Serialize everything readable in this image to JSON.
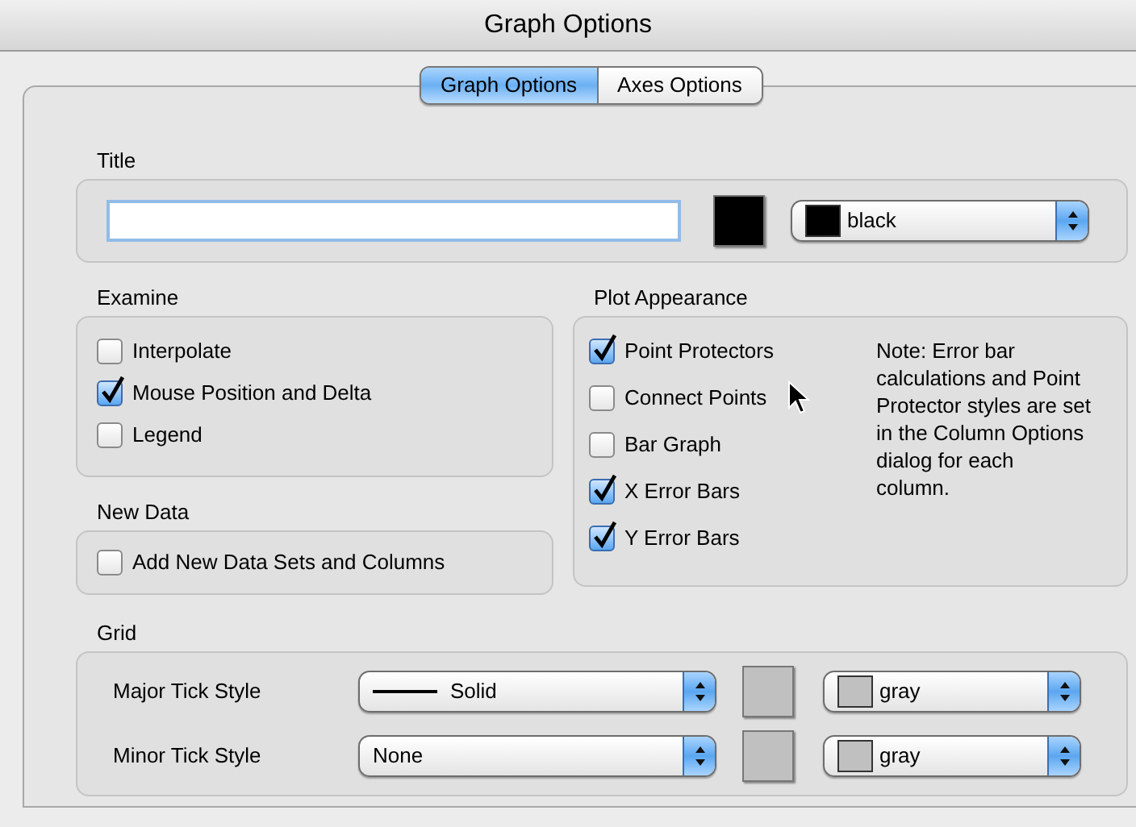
{
  "window": {
    "title": "Graph Options"
  },
  "tabs": [
    {
      "label": "Graph Options",
      "selected": true
    },
    {
      "label": "Axes Options",
      "selected": false
    }
  ],
  "title_section": {
    "label": "Title",
    "color_swatch": {
      "color": "#000000"
    },
    "color_select": {
      "label": "black",
      "color": "#000000"
    }
  },
  "examine": {
    "label": "Examine",
    "options": [
      {
        "label": "Interpolate",
        "checked": false
      },
      {
        "label": "Mouse Position and Delta",
        "checked": true
      },
      {
        "label": "Legend",
        "checked": false
      }
    ]
  },
  "new_data": {
    "label": "New Data",
    "options": [
      {
        "label": "Add New Data Sets and Columns",
        "checked": false
      }
    ]
  },
  "plot_appearance": {
    "label": "Plot Appearance",
    "options": [
      {
        "label": "Point Protectors",
        "checked": true
      },
      {
        "label": "Connect Points",
        "checked": false
      },
      {
        "label": "Bar Graph",
        "checked": false
      },
      {
        "label": "X Error Bars",
        "checked": true
      },
      {
        "label": "Y Error Bars",
        "checked": true
      }
    ],
    "note": "Note: Error bar calculations and Point Protector styles are set in the Column Options dialog for each column."
  },
  "grid": {
    "label": "Grid",
    "rows": [
      {
        "label": "Major Tick Style",
        "style": {
          "label": "Solid",
          "kind": "line"
        },
        "swatch": {
          "color": "#c0c0c0"
        },
        "color_select": {
          "label": "gray",
          "color": "#c0c0c0"
        }
      },
      {
        "label": "Minor Tick Style",
        "style": {
          "label": "None",
          "kind": "none"
        },
        "swatch": {
          "color": "#c0c0c0"
        },
        "color_select": {
          "label": "gray",
          "color": "#c0c0c0"
        }
      }
    ]
  }
}
